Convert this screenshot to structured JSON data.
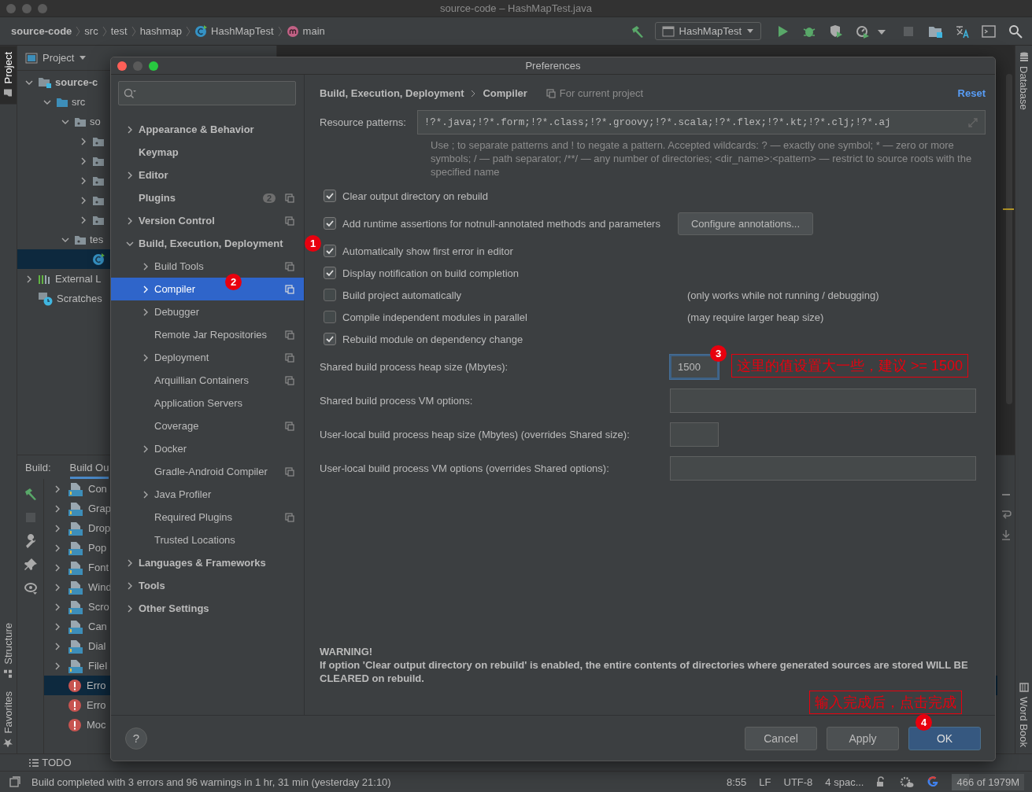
{
  "window": {
    "title": "source-code – HashMapTest.java"
  },
  "breadcrumbs": [
    {
      "label": "source-code",
      "kind": "project"
    },
    {
      "label": "src",
      "kind": "folder"
    },
    {
      "label": "test",
      "kind": "folder"
    },
    {
      "label": "hashmap",
      "kind": "folder"
    },
    {
      "label": "HashMapTest",
      "kind": "class"
    },
    {
      "label": "main",
      "kind": "method"
    }
  ],
  "run_config": "HashMapTest",
  "left_stripe": {
    "top": [
      {
        "label": "Project",
        "selected": true
      }
    ],
    "bottom": [
      {
        "label": "Structure",
        "selected": false
      },
      {
        "label": "Favorites",
        "selected": false
      }
    ]
  },
  "right_stripe": {
    "top": [
      "Database"
    ],
    "bottom": [
      "Word Book"
    ]
  },
  "project_panel": {
    "title": "Project",
    "tree": [
      {
        "label": "source-c",
        "kind": "module",
        "expanded": true,
        "selected": false,
        "children": [
          {
            "label": "src",
            "kind": "source",
            "expanded": true,
            "selected": false,
            "children": [
              {
                "label": "so",
                "kind": "package",
                "expanded": true,
                "selected": false,
                "children": [
                  {
                    "kind": "package",
                    "expanded": false,
                    "selected": false
                  },
                  {
                    "kind": "package",
                    "expanded": false,
                    "selected": false
                  },
                  {
                    "kind": "package",
                    "expanded": false,
                    "selected": false
                  },
                  {
                    "kind": "package",
                    "expanded": false,
                    "selected": false
                  },
                  {
                    "kind": "package",
                    "expanded": false,
                    "selected": false
                  }
                ]
              },
              {
                "label": "tes",
                "kind": "package",
                "expanded": true,
                "selected": false,
                "children": [
                  {
                    "kind": "class",
                    "selected": true
                  }
                ]
              }
            ]
          }
        ]
      },
      {
        "label": "External L",
        "kind": "library",
        "expanded": false,
        "selected": false
      },
      {
        "label": "Scratches",
        "kind": "scratch",
        "selected": false
      }
    ]
  },
  "build_panel": {
    "label": "Build:",
    "tab": "Build Ou",
    "rows": [
      {
        "label": "Con",
        "kind": "file",
        "expanded": false,
        "selected": false
      },
      {
        "label": "Grap",
        "kind": "file",
        "expanded": false,
        "selected": false
      },
      {
        "label": "Drop",
        "kind": "file",
        "expanded": false,
        "selected": false
      },
      {
        "label": "Pop",
        "kind": "file",
        "expanded": false,
        "selected": false
      },
      {
        "label": "Font",
        "kind": "file",
        "expanded": false,
        "selected": false
      },
      {
        "label": "Wind",
        "kind": "file",
        "expanded": false,
        "selected": false
      },
      {
        "label": "Scro",
        "kind": "file",
        "expanded": false,
        "selected": false
      },
      {
        "label": "Can",
        "kind": "file",
        "expanded": false,
        "selected": false
      },
      {
        "label": "Dial",
        "kind": "file",
        "expanded": false,
        "selected": false
      },
      {
        "label": "FileI",
        "kind": "file",
        "expanded": false,
        "selected": false
      },
      {
        "label": "Erro",
        "kind": "error",
        "selected": true
      },
      {
        "label": "Erro",
        "kind": "error",
        "selected": false
      },
      {
        "label": "Moc",
        "kind": "error",
        "selected": false
      }
    ]
  },
  "tool_tabs": [
    {
      "label": "TODO"
    }
  ],
  "status_bar": {
    "message": "Build completed with 3 errors and 96 warnings in 1 hr, 31 min (yesterday 21:10)",
    "items": [
      "8:55",
      "LF",
      "UTF-8",
      "4 spac..."
    ],
    "memory": {
      "text": "466 of 1979M",
      "level": 0.24
    }
  },
  "dialog": {
    "title": "Preferences",
    "settings_tree": [
      {
        "label": "Appearance & Behavior",
        "expanded": false,
        "selected": false
      },
      {
        "label": "Keymap",
        "selected": false
      },
      {
        "label": "Editor",
        "expanded": false,
        "selected": false
      },
      {
        "label": "Plugins",
        "selected": false,
        "badge": "2",
        "project_level": true
      },
      {
        "label": "Version Control",
        "expanded": false,
        "selected": false,
        "project_level": true
      },
      {
        "label": "Build, Execution, Deployment",
        "expanded": true,
        "selected": false,
        "marker": "1",
        "children": [
          {
            "label": "Build Tools",
            "expanded": false,
            "selected": false,
            "project_level": true
          },
          {
            "label": "Compiler",
            "expanded": false,
            "selected": true,
            "project_level": true,
            "marker": "2"
          },
          {
            "label": "Debugger",
            "expanded": false,
            "selected": false
          },
          {
            "label": "Remote Jar Repositories",
            "selected": false,
            "project_level": true
          },
          {
            "label": "Deployment",
            "expanded": false,
            "selected": false,
            "project_level": true
          },
          {
            "label": "Arquillian Containers",
            "selected": false,
            "project_level": true
          },
          {
            "label": "Application Servers",
            "selected": false
          },
          {
            "label": "Coverage",
            "selected": false,
            "project_level": true
          },
          {
            "label": "Docker",
            "expanded": false,
            "selected": false
          },
          {
            "label": "Gradle-Android Compiler",
            "selected": false,
            "project_level": true
          },
          {
            "label": "Java Profiler",
            "expanded": false,
            "selected": false
          },
          {
            "label": "Required Plugins",
            "selected": false,
            "project_level": true
          },
          {
            "label": "Trusted Locations",
            "selected": false
          }
        ]
      },
      {
        "label": "Languages & Frameworks",
        "expanded": false,
        "selected": false
      },
      {
        "label": "Tools",
        "expanded": false,
        "selected": false
      },
      {
        "label": "Other Settings",
        "expanded": false,
        "selected": false
      }
    ],
    "page": {
      "breadcrumb": [
        "Build, Execution, Deployment",
        "Compiler"
      ],
      "scope": "For current project",
      "reset": "Reset",
      "resource_patterns": {
        "label": "Resource patterns:",
        "value": "!?*.java;!?*.form;!?*.class;!?*.groovy;!?*.scala;!?*.flex;!?*.kt;!?*.clj;!?*.aj"
      },
      "hint": "Use ; to separate patterns and ! to negate a pattern. Accepted wildcards: ? — exactly one symbol; * — zero or more symbols; / — path separator; /**/ — any number of directories; <dir_name>:<pattern> — restrict to source roots with the specified name",
      "options": [
        {
          "label": "Clear output directory on rebuild",
          "checked": true
        },
        {
          "label": "Add runtime assertions for notnull-annotated methods and parameters",
          "checked": true,
          "button": "Configure annotations..."
        },
        {
          "label": "Automatically show first error in editor",
          "checked": true
        },
        {
          "label": "Display notification on build completion",
          "checked": true
        },
        {
          "label": "Build project automatically",
          "checked": false,
          "note": "(only works while not running / debugging)"
        },
        {
          "label": "Compile independent modules in parallel",
          "checked": false,
          "note": "(may require larger heap size)"
        },
        {
          "label": "Rebuild module on dependency change",
          "checked": true
        }
      ],
      "fields": [
        {
          "label": "Shared build process heap size (Mbytes):",
          "kind": "number",
          "value": "1500",
          "focused": true,
          "marker": "3",
          "callout": "这里的值设置大一些，建议 >= 1500"
        },
        {
          "label": "Shared build process VM options:",
          "kind": "text",
          "focused": false
        },
        {
          "label": "User-local build process heap size (Mbytes) (overrides Shared size):",
          "kind": "number",
          "focused": false
        },
        {
          "label": "User-local build process VM options (overrides Shared options):",
          "kind": "text",
          "focused": false
        }
      ],
      "warning": {
        "title": "WARNING!",
        "text": "If option 'Clear output directory on rebuild' is enabled, the entire contents of directories where generated sources are stored WILL BE CLEARED on rebuild."
      }
    },
    "buttons": [
      {
        "label": "Cancel",
        "kind": "normal"
      },
      {
        "label": "Apply",
        "kind": "normal"
      },
      {
        "label": "OK",
        "kind": "default",
        "marker": "4",
        "callout": "输入完成后，点击完成"
      }
    ],
    "help": "?"
  }
}
